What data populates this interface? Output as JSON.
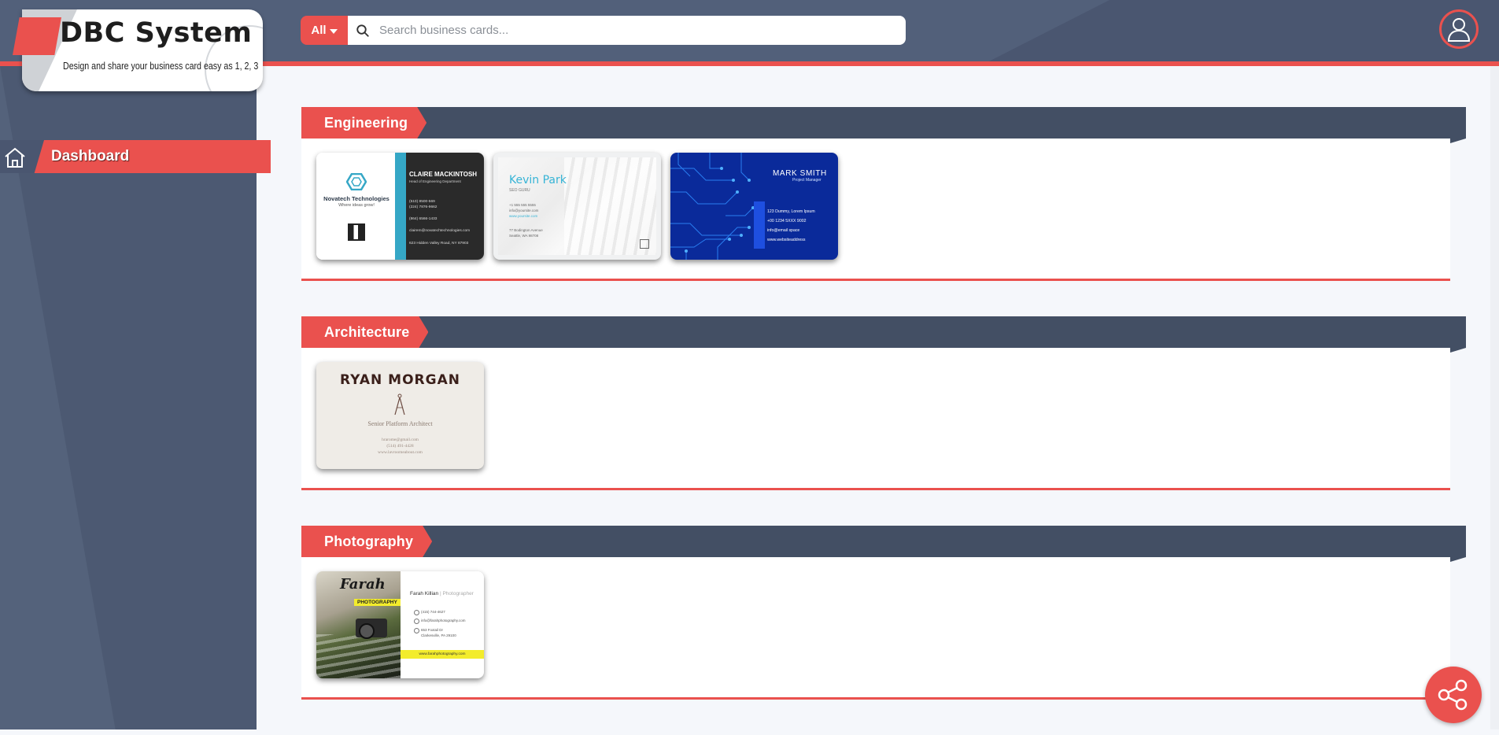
{
  "app": {
    "title": "DBC System",
    "tagline": "Design and share your business card easy as 1, 2, 3"
  },
  "search": {
    "filter_label": "All",
    "placeholder": "Search business cards...",
    "value": ""
  },
  "icons": {
    "search": "search-icon",
    "profile": "user-icon",
    "home": "home-icon",
    "share": "share-icon",
    "filter_caret": "caret-down-icon"
  },
  "sidebar": {
    "items": [
      {
        "label": "Dashboard",
        "icon": "home-icon",
        "active": true
      }
    ]
  },
  "colors": {
    "accent": "#ea514e",
    "header": "#52607a",
    "category_bar": "#434f64"
  },
  "categories": [
    {
      "name": "Engineering",
      "cards": [
        {
          "id": "novatech",
          "company": "Novatech Technologies",
          "slogan": "Where ideas grow!",
          "name": "CLAIRE MACKINTOSH",
          "role": "Head of Engineering Department",
          "lines": [
            "(510) 8500-569",
            "(224) 7876-9662",
            "(864) 6566-1433",
            "clairem@novatechtechnologies.com",
            "623 Hidden Valley Road, NY 87903"
          ]
        },
        {
          "id": "kevin",
          "name": "Kevin Park",
          "role": "SEO GURU",
          "lines": [
            "+1 555 555 5555",
            "info@yoursite.com",
            "www.yoursite.com",
            "77 Bodington Avenue",
            "Seattle, WA 98708"
          ]
        },
        {
          "id": "mark",
          "name": "MARK SMITH",
          "role": "Project Manager",
          "lines": [
            "123 Dummy, Lorem Ipsum",
            "+00 1234 5XXX 9002",
            "info@email space",
            "www.websiteaddress"
          ]
        }
      ]
    },
    {
      "name": "Architecture",
      "cards": [
        {
          "id": "ryan",
          "name": "RYAN MORGAN",
          "role": "Senior Platform Architect",
          "lines": [
            "hrarome@gmail.com",
            "(514) 491-4428",
            "www.lavroomeabout.com"
          ]
        }
      ]
    },
    {
      "name": "Photography",
      "cards": [
        {
          "id": "farah",
          "brand": "Farah",
          "tag": "PHOTOGRAPHY",
          "name": "Farah Killian",
          "role": "Photographer",
          "lines": [
            "(415) 744-4627",
            "info@farahphotography.com",
            "653 Foxtail Dr",
            "Clarkesville, PA 29100"
          ],
          "website": "www.farahphotography.com"
        }
      ]
    }
  ]
}
